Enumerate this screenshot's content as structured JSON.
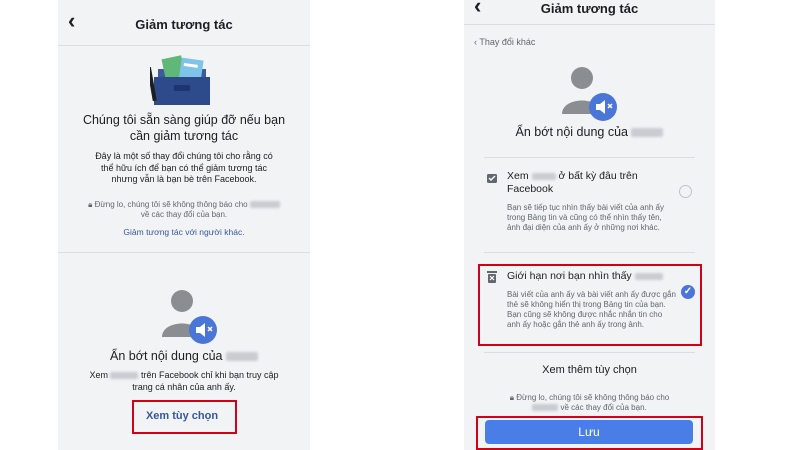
{
  "left": {
    "header": {
      "title": "Giảm tương tác"
    },
    "intro": {
      "heading": "Chúng tôi sẵn sàng giúp đỡ nếu bạn cần giảm tương tác",
      "body": "Đây là một số thay đổi chúng tôi cho rằng có thể hữu ích để bạn có thể giảm tương tác nhưng vẫn là bạn bè trên Facebook.",
      "notice_prefix": "Đừng lo, chúng tôi sẽ không thông báo cho",
      "notice_suffix": "về các thay đổi của bạn.",
      "link": "Giảm tương tác với người khác."
    },
    "option": {
      "title_prefix": "Ẩn bớt nội dung của",
      "desc_prefix": "Xem",
      "desc_suffix": "trên Facebook chỉ khi bạn truy cập trang cá nhân của anh ấy.",
      "button": "Xem tùy chọn"
    }
  },
  "right": {
    "header": {
      "title": "Giảm tương tác"
    },
    "back_link": "Thay đổi khác",
    "heading_prefix": "Ẩn bớt nội dung của",
    "options": [
      {
        "title_prefix": "Xem",
        "title_suffix": "ở bất kỳ đâu trên Facebook",
        "desc": "Bạn sẽ tiếp tục nhìn thấy bài viết của anh ấy trong Bảng tin và cũng có thể nhìn thấy tên, ảnh đại diện của anh ấy ở những nơi khác.",
        "selected": false
      },
      {
        "title_prefix": "Giới hạn nơi bạn nhìn thấy",
        "desc": "Bài viết của anh ấy và bài viết anh ấy được gắn thẻ sẽ không hiển thị trong Bảng tin của bạn. Bạn cũng sẽ không được nhắc nhắn tin cho anh ấy hoặc gắn thẻ anh ấy trong ảnh.",
        "selected": true
      }
    ],
    "more": "Xem thêm tùy chọn",
    "notice_prefix": "Đừng lo, chúng tôi sẽ không thông báo cho",
    "notice_suffix": "về các thay đổi của bạn.",
    "save": "Lưu"
  },
  "colors": {
    "highlight": "#d0021b",
    "accent": "#4a7ee6",
    "link": "#365899",
    "background": "#f2f3f5"
  }
}
